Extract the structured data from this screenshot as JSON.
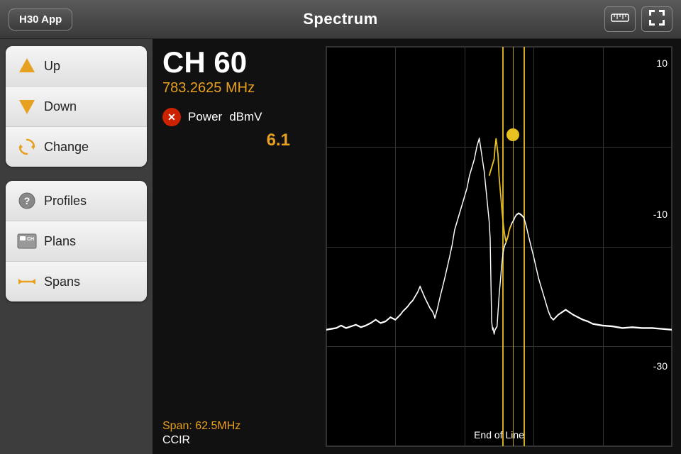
{
  "header": {
    "app_label": "H30 App",
    "title": "Spectrum",
    "ruler_icon": "📏",
    "select_icon": "⬜"
  },
  "sidebar": {
    "group1": [
      {
        "id": "up",
        "label": "Up",
        "icon_type": "arrow-up"
      },
      {
        "id": "down",
        "label": "Down",
        "icon_type": "arrow-down"
      },
      {
        "id": "change",
        "label": "Change",
        "icon_type": "refresh"
      }
    ],
    "group2": [
      {
        "id": "profiles",
        "label": "Profiles",
        "icon_type": "profiles"
      },
      {
        "id": "plans",
        "label": "Plans",
        "icon_type": "plans"
      },
      {
        "id": "spans",
        "label": "Spans",
        "icon_type": "spans"
      }
    ]
  },
  "channel": {
    "name": "CH 60",
    "frequency": "783.2625 MHz",
    "power_label": "Power",
    "power_unit": "dBmV",
    "power_value": "6.1",
    "span_label": "Span: 62.5MHz",
    "standard": "CCIR"
  },
  "chart": {
    "y_labels": [
      "10",
      "-10",
      "-30"
    ],
    "x_label": "End of Line",
    "grid_cols": 5,
    "grid_rows": 4
  }
}
